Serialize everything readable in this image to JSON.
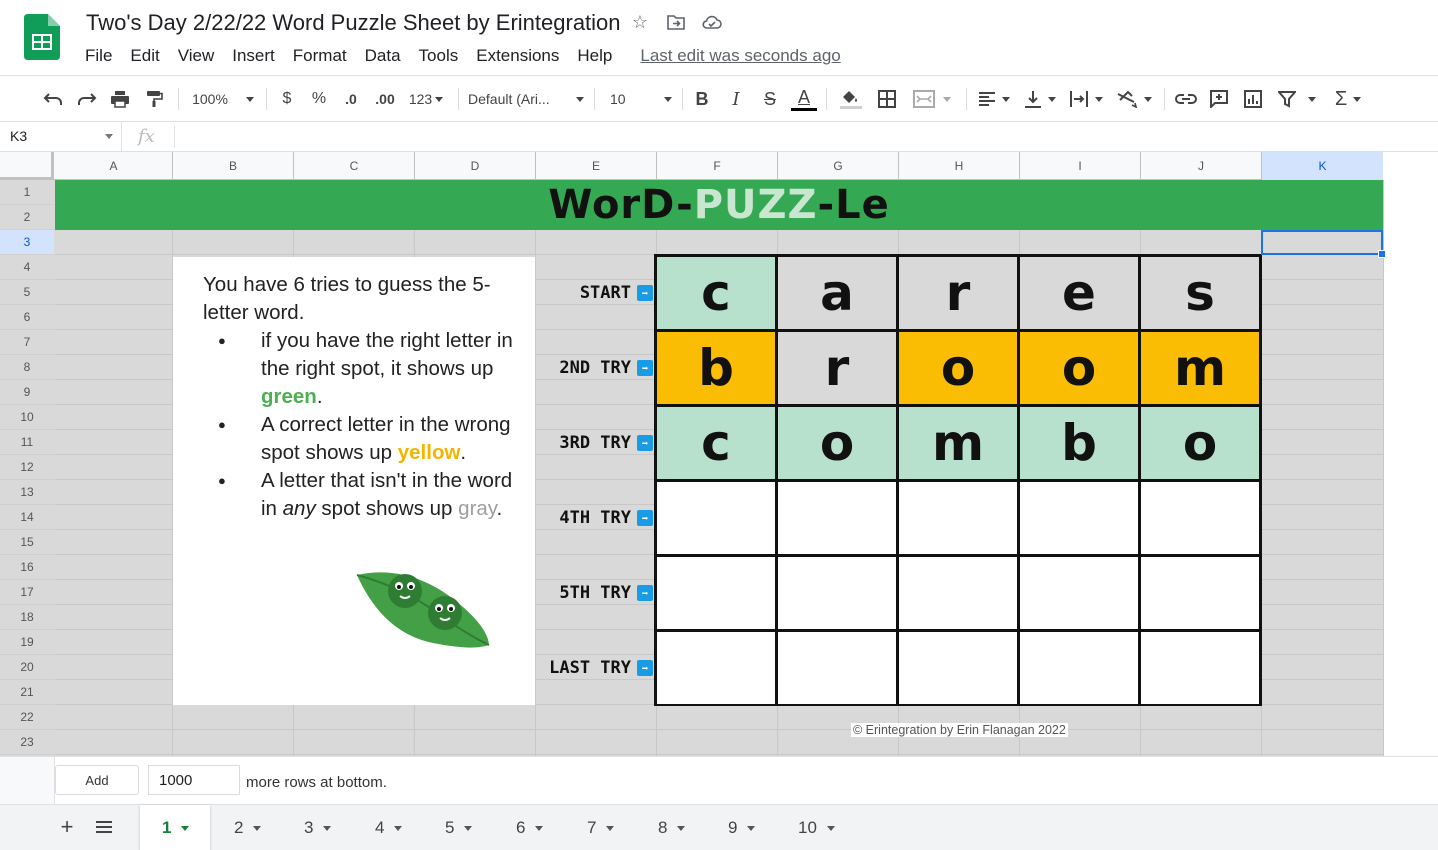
{
  "header": {
    "title": "Two's Day 2/22/22 Word Puzzle Sheet by Erintegration",
    "menu": [
      "File",
      "Edit",
      "View",
      "Insert",
      "Format",
      "Data",
      "Tools",
      "Extensions",
      "Help"
    ],
    "last_edit": "Last edit was seconds ago"
  },
  "toolbar": {
    "zoom": "100%",
    "currency": "$",
    "percent": "%",
    "dec_decrease": ".0",
    "dec_increase": ".00",
    "more_formats": "123",
    "font": "Default (Ari...",
    "font_size": "10",
    "bold": "B",
    "italic": "I",
    "strike": "S",
    "text_color": "A",
    "sum": "Σ"
  },
  "formula_bar": {
    "cell_ref": "K3",
    "fx": "fx",
    "value": ""
  },
  "grid": {
    "columns": [
      "A",
      "B",
      "C",
      "D",
      "E",
      "F",
      "G",
      "H",
      "I",
      "J",
      "K"
    ],
    "rows": [
      "1",
      "2",
      "3",
      "4",
      "5",
      "6",
      "7",
      "8",
      "9",
      "10",
      "11",
      "12",
      "13",
      "14",
      "15",
      "16",
      "17",
      "18",
      "19",
      "20",
      "21",
      "22",
      "23"
    ]
  },
  "puzzle": {
    "banner": {
      "part1": "WorD-",
      "part2": "PUZZ",
      "part3": "-Le"
    },
    "instructions": {
      "intro": "You have 6 tries to guess the 5-letter word.",
      "b1_pre": "if you have the right letter in the right spot, it shows up ",
      "b1_color": "green",
      "b1_post": ".",
      "b2_pre": "A correct letter in the wrong spot shows up ",
      "b2_color": "yellow",
      "b2_post": ".",
      "b3_pre": "A letter that isn't in the word in ",
      "b3_em": "any",
      "b3_mid": " spot shows up ",
      "b3_color": "gray",
      "b3_post": "."
    },
    "tries": [
      "START",
      "2ND TRY",
      "3RD TRY",
      "4TH TRY",
      "5TH TRY",
      "LAST TRY"
    ],
    "board": [
      [
        {
          "l": "c",
          "s": "green"
        },
        {
          "l": "a",
          "s": "gray"
        },
        {
          "l": "r",
          "s": "gray"
        },
        {
          "l": "e",
          "s": "gray"
        },
        {
          "l": "s",
          "s": "gray"
        }
      ],
      [
        {
          "l": "b",
          "s": "yellow"
        },
        {
          "l": "r",
          "s": "gray"
        },
        {
          "l": "o",
          "s": "yellow"
        },
        {
          "l": "o",
          "s": "yellow"
        },
        {
          "l": "m",
          "s": "yellow"
        }
      ],
      [
        {
          "l": "c",
          "s": "green"
        },
        {
          "l": "o",
          "s": "green"
        },
        {
          "l": "m",
          "s": "green"
        },
        {
          "l": "b",
          "s": "green"
        },
        {
          "l": "o",
          "s": "green"
        }
      ],
      [
        {
          "l": "",
          "s": "empty"
        },
        {
          "l": "",
          "s": "empty"
        },
        {
          "l": "",
          "s": "empty"
        },
        {
          "l": "",
          "s": "empty"
        },
        {
          "l": "",
          "s": "empty"
        }
      ],
      [
        {
          "l": "",
          "s": "empty"
        },
        {
          "l": "",
          "s": "empty"
        },
        {
          "l": "",
          "s": "empty"
        },
        {
          "l": "",
          "s": "empty"
        },
        {
          "l": "",
          "s": "empty"
        }
      ],
      [
        {
          "l": "",
          "s": "empty"
        },
        {
          "l": "",
          "s": "empty"
        },
        {
          "l": "",
          "s": "empty"
        },
        {
          "l": "",
          "s": "empty"
        },
        {
          "l": "",
          "s": "empty"
        }
      ]
    ],
    "copyright": "© Erintegration by Erin Flanagan 2022"
  },
  "add_rows": {
    "button": "Add",
    "count": "1000",
    "suffix": "more rows at bottom."
  },
  "sheets": {
    "tabs": [
      "1",
      "2",
      "3",
      "4",
      "5",
      "6",
      "7",
      "8",
      "9",
      "10"
    ],
    "active": "1"
  },
  "colors": {
    "banner": "#34a853",
    "green_tile": "#b7e1cd",
    "yellow_tile": "#fbbc04",
    "gray_tile": "#d9d9d9",
    "selection": "#1a73e8"
  }
}
